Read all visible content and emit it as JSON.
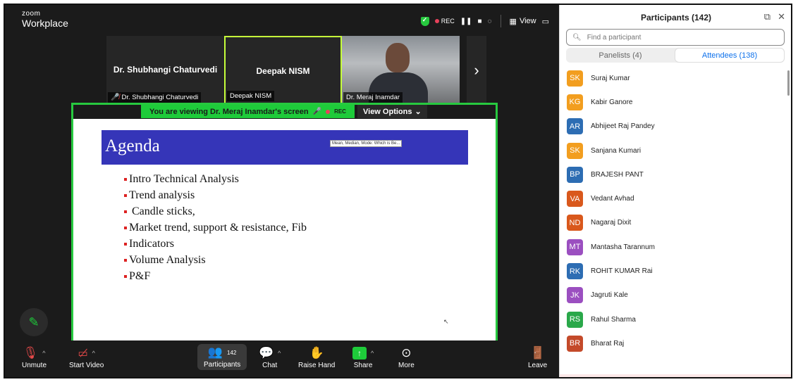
{
  "app": {
    "brand_small": "zoom",
    "brand_big": "Workplace"
  },
  "topbar": {
    "rec": "REC",
    "view": "View"
  },
  "thumbnails": [
    {
      "center_name": "Dr. Shubhangi Chaturvedi",
      "label": "Dr. Shubhangi Chaturvedi",
      "muted": true
    },
    {
      "center_name": "Deepak NISM",
      "label": "Deepak NISM",
      "muted": false
    },
    {
      "center_name": "",
      "label": "Dr. Meraj Inamdar",
      "muted": false
    }
  ],
  "share_banner": {
    "text": "You are viewing  Dr. Meraj Inamdar's screen",
    "rec": "REC",
    "view_options": "View Options"
  },
  "slide": {
    "title": "Agenda",
    "tooltip": "Mean, Median, Mode: Which is Be...",
    "bullets": [
      "Intro Technical Analysis",
      "Trend analysis",
      " Candle sticks,",
      "Market trend, support & resistance, Fib",
      "Indicators",
      "Volume Analysis",
      "P&F"
    ]
  },
  "toolbar": {
    "unmute": "Unmute",
    "start_video": "Start Video",
    "participants": "Participants",
    "participants_count": "142",
    "chat": "Chat",
    "raise_hand": "Raise Hand",
    "share": "Share",
    "more": "More",
    "leave": "Leave"
  },
  "panel": {
    "title": "Participants (142)",
    "search_placeholder": "Find a participant",
    "tab_panelists": "Panelists (4)",
    "tab_attendees": "Attendees (138)",
    "attendees": [
      {
        "initials": "SK",
        "name": "Suraj Kumar",
        "color": "#f29e1f"
      },
      {
        "initials": "KG",
        "name": "Kabir Ganore",
        "color": "#f29e1f"
      },
      {
        "initials": "AR",
        "name": "Abhijeet Raj Pandey",
        "color": "#2d6db3"
      },
      {
        "initials": "SK",
        "name": "Sanjana Kumari",
        "color": "#f29e1f"
      },
      {
        "initials": "BP",
        "name": "BRAJESH PANT",
        "color": "#2d6db3"
      },
      {
        "initials": "VA",
        "name": "Vedant Avhad",
        "color": "#d9581c"
      },
      {
        "initials": "ND",
        "name": "Nagaraj Dixit",
        "color": "#d9581c"
      },
      {
        "initials": "MT",
        "name": "Mantasha Tarannum",
        "color": "#9b4fc0"
      },
      {
        "initials": "RK",
        "name": "ROHIT KUMAR Rai",
        "color": "#2d6db3"
      },
      {
        "initials": "JK",
        "name": "Jagruti Kale",
        "color": "#9b4fc0"
      },
      {
        "initials": "RS",
        "name": "Rahul Sharma",
        "color": "#2aa84a"
      },
      {
        "initials": "BR",
        "name": "Bharat Raj",
        "color": "#c44a2a"
      }
    ]
  },
  "colors": {
    "accent_green": "#1ecb3a",
    "zoom_blue": "#0e71eb",
    "slide_blue": "#3535b8",
    "rec_red": "#e8415b"
  }
}
